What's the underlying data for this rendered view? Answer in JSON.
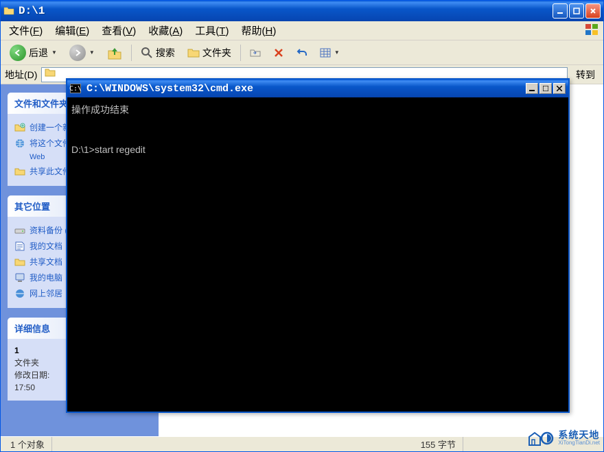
{
  "explorer": {
    "title": "D:\\1",
    "menus": [
      {
        "label": "文件",
        "key": "F"
      },
      {
        "label": "编辑",
        "key": "E"
      },
      {
        "label": "查看",
        "key": "V"
      },
      {
        "label": "收藏",
        "key": "A"
      },
      {
        "label": "工具",
        "key": "T"
      },
      {
        "label": "帮助",
        "key": "H"
      }
    ],
    "toolbar": {
      "back": "后退",
      "search": "搜索",
      "folders": "文件夹"
    },
    "address_label": "地址(D)",
    "goto": "转到"
  },
  "panels": {
    "tasks": {
      "title": "文件和文件夹任务",
      "items": [
        {
          "icon": "new-folder",
          "label": "创建一个新文件夹"
        },
        {
          "icon": "publish-web",
          "label": "将这个文件夹发布到 Web"
        },
        {
          "icon": "share",
          "label": "共享此文件夹"
        }
      ]
    },
    "other": {
      "title": "其它位置",
      "items": [
        {
          "icon": "drive",
          "label": "资料备份 (D:)"
        },
        {
          "icon": "my-docs",
          "label": "我的文档"
        },
        {
          "icon": "shared-docs",
          "label": "共享文档"
        },
        {
          "icon": "my-computer",
          "label": "我的电脑"
        },
        {
          "icon": "network",
          "label": "网上邻居"
        }
      ]
    },
    "details": {
      "title": "详细信息",
      "name": "1",
      "type": "文件夹",
      "modified_label": "修改日期:",
      "modified_time": "17:50"
    }
  },
  "status": {
    "left": "1 个对象",
    "right": "155 字节"
  },
  "cmd": {
    "title": "C:\\WINDOWS\\system32\\cmd.exe",
    "icon_text": "C:\\",
    "line1": "操作成功结束",
    "line2": "D:\\1>start regedit"
  },
  "watermark": {
    "cn": "系统天地",
    "en": "XiTongTianDi.net"
  }
}
